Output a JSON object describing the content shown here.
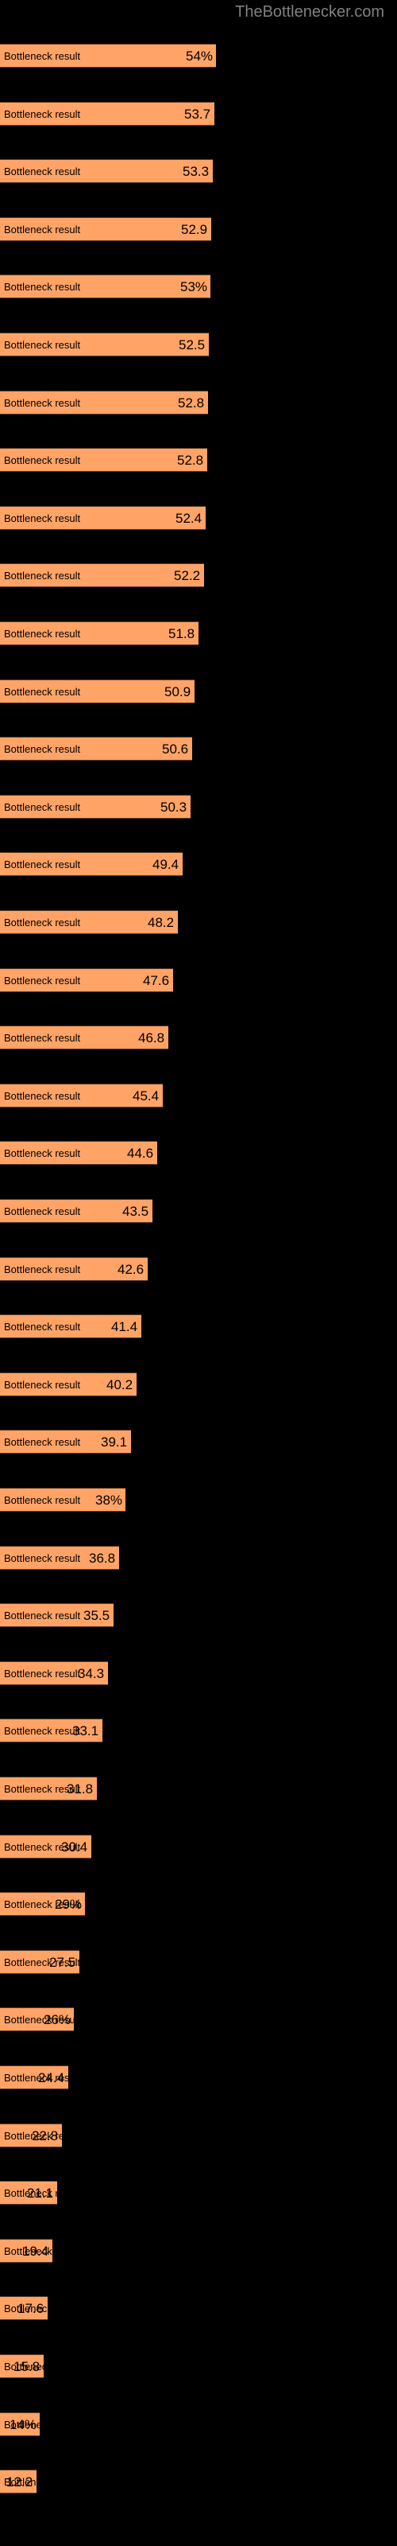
{
  "header": {
    "site_title": "TheBottlenecker.com",
    "title_color": "#808080"
  },
  "theme": {
    "background": "#000000",
    "bar_fill": "#ffa366",
    "bar_border": "#5a3a22",
    "text_color": "#000000"
  },
  "chart_data": {
    "type": "bar",
    "orientation": "horizontal",
    "title": "TheBottlenecker.com",
    "xlabel": "",
    "ylabel": "",
    "grid": false,
    "legend": false,
    "value_suffix": "%",
    "series_label": "Bottleneck result",
    "xlim": [
      0,
      54
    ],
    "categories": [
      "Bottleneck result",
      "Bottleneck result",
      "Bottleneck result",
      "Bottleneck result",
      "Bottleneck result",
      "Bottleneck result",
      "Bottleneck result",
      "Bottleneck result",
      "Bottleneck result",
      "Bottleneck result",
      "Bottleneck result",
      "Bottleneck result",
      "Bottleneck result",
      "Bottleneck result",
      "Bottleneck result",
      "Bottleneck result",
      "Bottleneck result",
      "Bottleneck result",
      "Bottleneck result",
      "Bottleneck result",
      "Bottleneck result",
      "Bottleneck result",
      "Bottleneck result",
      "Bottleneck result",
      "Bottleneck result",
      "Bottleneck result",
      "Bottleneck result",
      "Bottleneck result",
      "Bottleneck result",
      "Bottleneck result",
      "Bottleneck result",
      "Bottleneck result",
      "Bottleneck result",
      "Bottleneck result",
      "Bottleneck result",
      "Bottleneck result",
      "Bottleneck result",
      "Bottleneck result",
      "Bottleneck result",
      "Bottleneck result",
      "Bottleneck result",
      "Bottleneck result",
      "Bottleneck result"
    ],
    "values": [
      54,
      53.7,
      53.3,
      52.9,
      53,
      52.5,
      52.8,
      52.8,
      52.4,
      52.2,
      51.8,
      50.9,
      50.6,
      50.3,
      49.4,
      48.2,
      47.6,
      46.8,
      45.4,
      44.6,
      43.5,
      42.6,
      41.4,
      40.2,
      39.1,
      38,
      36.8,
      35.5,
      34.3,
      33.1,
      31.8,
      30.4,
      29,
      27.5,
      26,
      24.4,
      22.8,
      21.1,
      19.4,
      17.6,
      15.8,
      14,
      12.2
    ],
    "value_labels": [
      "54%",
      "53.7",
      "53.3",
      "52.9",
      "53%",
      "52.5",
      "52.8",
      "52.8",
      "52.4",
      "52.2",
      "51.8",
      "50.9",
      "50.6",
      "50.3",
      "49.4",
      "48.2",
      "47.6",
      "46.8",
      "45.4",
      "44.6",
      "43.5",
      "42.6",
      "41.4",
      "40.2",
      "39.1",
      "38%",
      "36.8",
      "35.5",
      "34.3",
      "33.1",
      "31.8",
      "30.4",
      "29%",
      "27.5",
      "26%",
      "24.4",
      "22.8",
      "21.1",
      "19.4",
      "17.6",
      "15.8",
      "14%",
      "12.2"
    ],
    "bar_pixel_widths": [
      272,
      270,
      268,
      266,
      265,
      263,
      262,
      261,
      259,
      257,
      250,
      245,
      242,
      240,
      230,
      224,
      218,
      212,
      205,
      198,
      192,
      186,
      178,
      172,
      165,
      158,
      150,
      143,
      136,
      129,
      122,
      115,
      107,
      100,
      93,
      86,
      78,
      72,
      66,
      60,
      55,
      50,
      46
    ]
  }
}
